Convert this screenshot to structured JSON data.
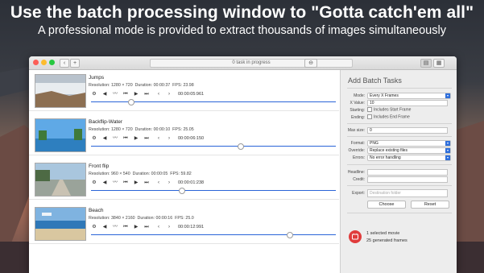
{
  "banner": {
    "headline": "Use the batch processing window to \"Gotta catch'em all\"",
    "subheadline": "A professional mode is provided to extract thousands of images simultaneously"
  },
  "window": {
    "title_status": "0 task in progress",
    "toolbar": {
      "back": "‹",
      "add": "+",
      "minus": "−"
    }
  },
  "tasks": [
    {
      "name": "Jumps",
      "resolution_label": "Resolution:",
      "resolution": "1280 × 720",
      "duration_label": "Duration:",
      "duration": "00:00:37",
      "fps_label": "FPS:",
      "fps": "23.98",
      "timecode": "00:00:05:961",
      "progress": 0.16
    },
    {
      "name": "Backflip-Water",
      "resolution_label": "Resolution:",
      "resolution": "1280 × 720",
      "duration_label": "Duration:",
      "duration": "00:00:10",
      "fps_label": "FPS:",
      "fps": "25.05",
      "timecode": "00:00:06:150",
      "progress": 0.61
    },
    {
      "name": "Front flip",
      "resolution_label": "Resolution:",
      "resolution": "960 × 540",
      "duration_label": "Duration:",
      "duration": "00:00:05",
      "fps_label": "FPS:",
      "fps": "59.82",
      "timecode": "00:00:01:238",
      "progress": 0.37
    },
    {
      "name": "Beach",
      "resolution_label": "Resolution:",
      "resolution": "3840 × 2160",
      "duration_label": "Duration:",
      "duration": "00:00:16",
      "fps_label": "FPS:",
      "fps": "25.0",
      "timecode": "00:00:12:991",
      "progress": 0.81
    }
  ],
  "controls": {
    "settings": "⚙",
    "prev": "◀",
    "waveform": "〰",
    "skip_back": "⏮",
    "play": "▶",
    "skip_fwd": "⏭",
    "chev_left": "‹",
    "chev_right": "›"
  },
  "panel": {
    "title": "Add Batch Tasks",
    "mode_label": "Mode:",
    "mode_value": "Every X Frames",
    "xvalue_label": "X Value:",
    "xvalue": "10",
    "starting_label": "Starting:",
    "starting_check": "Includes Start Frame",
    "ending_label": "Ending:",
    "ending_check": "Includes End Frame",
    "maxsize_label": "Max size:",
    "maxsize_value": "0",
    "format_label": "Format:",
    "format_value": "PNG",
    "override_label": "Override:",
    "override_value": "Replace existing files",
    "errors_label": "Errors:",
    "errors_value": "No error handling",
    "headline_label": "Headline:",
    "credit_label": "Credit:",
    "export_label": "Export:",
    "export_placeholder": "Destination folder",
    "choose_button": "Choose",
    "reset_button": "Reset",
    "summary_movies": "1 selected movie",
    "summary_frames": "25 generated frames"
  },
  "colors": {
    "accent": "#2f6fdb",
    "close": "#fc5f57",
    "minimize": "#fdbc2e",
    "zoom": "#28c840",
    "summary_icon": "#e03c3c"
  }
}
